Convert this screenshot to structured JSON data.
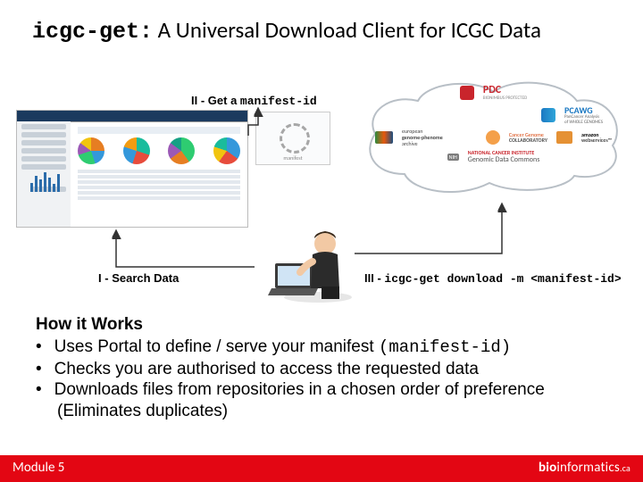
{
  "title": {
    "mono": "icgc-get:",
    "rest": " A Universal Download Client for ICGC Data"
  },
  "steps": {
    "s1": {
      "num": "I",
      "label": "Search Data"
    },
    "s2": {
      "num": "II",
      "label": "Get a ",
      "mono": "manifest-id"
    },
    "s3": {
      "num": "III",
      "mono": "icgc-get download -m <manifest-id>"
    }
  },
  "logos": {
    "pdc": "PDC",
    "pdc_sub": "BIONIMBUS PROTECTED",
    "pcawg": "PCAWG",
    "pcawg_sub": "PanCancer Analysis\nof WHOLE GENOMES",
    "ega_top": "european",
    "ega_mid": "genome-phenome",
    "ega_bot": "archive",
    "cgc_top": "Cancer Genome",
    "cgc_bot": "COLLABORATORY",
    "aws_top": "amazon",
    "aws_bot": "webservices™",
    "nih": "NIH",
    "gdc_top": "NATIONAL CANCER INSTITUTE",
    "gdc_bot": "Genomic Data Commons"
  },
  "how": {
    "header": "How it Works",
    "items": [
      {
        "pre": "Uses Portal to define / serve your manifest ",
        "mono": "(manifest-id)",
        "post": ""
      },
      {
        "pre": "Checks you are authorised to access the requested data",
        "mono": "",
        "post": ""
      },
      {
        "pre": "Downloads files from repositories in a chosen order of preference (Eliminates duplicates)",
        "mono": "",
        "post": ""
      }
    ]
  },
  "footer": {
    "module": "Module 5",
    "brand_bold": "bio",
    "brand_rest": "informatics",
    "brand_suffix": ".ca"
  }
}
